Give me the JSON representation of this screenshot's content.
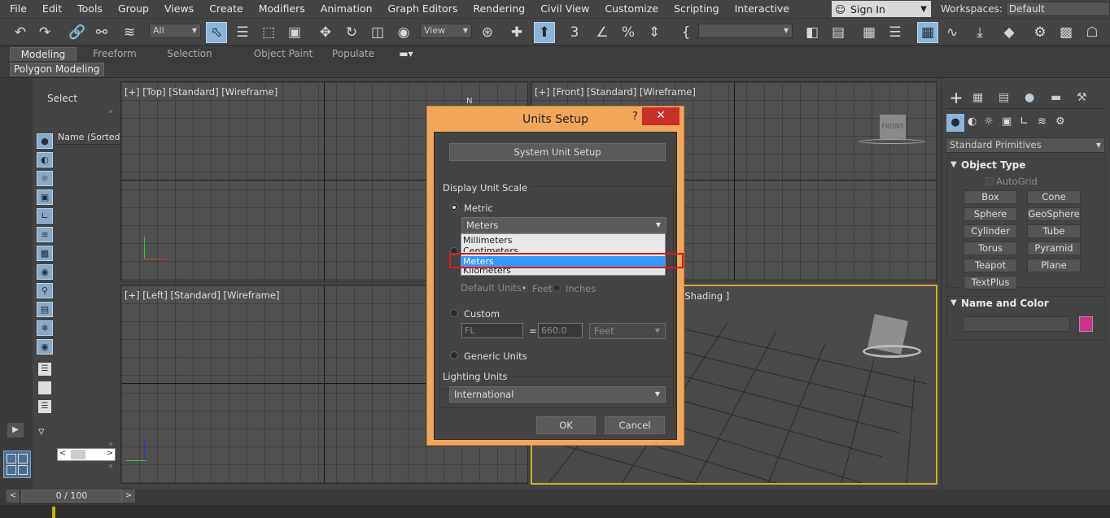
{
  "menubar": {
    "items": [
      "File",
      "Edit",
      "Tools",
      "Group",
      "Views",
      "Create",
      "Modifiers",
      "Animation",
      "Graph Editors",
      "Rendering",
      "Civil View",
      "Customize",
      "Scripting",
      "Interactive"
    ],
    "signin": "Sign In",
    "workspaces_label": "Workspaces:",
    "workspaces_value": "Default"
  },
  "toolbar": {
    "selection_filter": "All",
    "ref_coord": "View"
  },
  "ribbon": {
    "tabs": [
      "Modeling",
      "Freeform",
      "Selection",
      "Object Paint",
      "Populate"
    ],
    "active_tab": "Modeling",
    "panel": "Polygon Modeling"
  },
  "scene_explorer": {
    "title": "Select",
    "column": "Name (Sorted A"
  },
  "viewports": {
    "top": "[+] [Top] [Standard] [Wireframe]",
    "front": "[+] [Front] [Standard] [Wireframe]",
    "left": "[+] [Left] [Standard] [Wireframe]",
    "perspective": "lt Shading ]",
    "front_cube": "FRONT",
    "compass": "N"
  },
  "command_panel": {
    "category": "Standard Primitives",
    "object_type_title": "Object Type",
    "autogrid": "AutoGrid",
    "buttons": [
      "Box",
      "Cone",
      "Sphere",
      "GeoSphere",
      "Cylinder",
      "Tube",
      "Torus",
      "Pyramid",
      "Teapot",
      "Plane",
      "TextPlus"
    ],
    "name_color_title": "Name and Color",
    "color": "#d0308a"
  },
  "timeline": {
    "frame": "0 / 100"
  },
  "dialog": {
    "title": "Units Setup",
    "help": "?",
    "close": "✕",
    "system_unit_setup": "System Unit Setup",
    "display_unit_scale": "Display Unit Scale",
    "metric_label": "Metric",
    "metric_value": "Meters",
    "metric_options": [
      "Millimeters",
      "Centimeters",
      "Meters",
      "Kilometers"
    ],
    "metric_selected_index": 2,
    "default_units_label": "Default Units:",
    "default_units_feet": "Feet",
    "default_units_inches": "Inches",
    "custom_label": "Custom",
    "custom_name": "FL",
    "custom_equals": "=",
    "custom_value": "660.0",
    "custom_unit": "Feet",
    "generic_label": "Generic Units",
    "lighting_units_label": "Lighting Units",
    "lighting_units_value": "International",
    "ok": "OK",
    "cancel": "Cancel"
  }
}
